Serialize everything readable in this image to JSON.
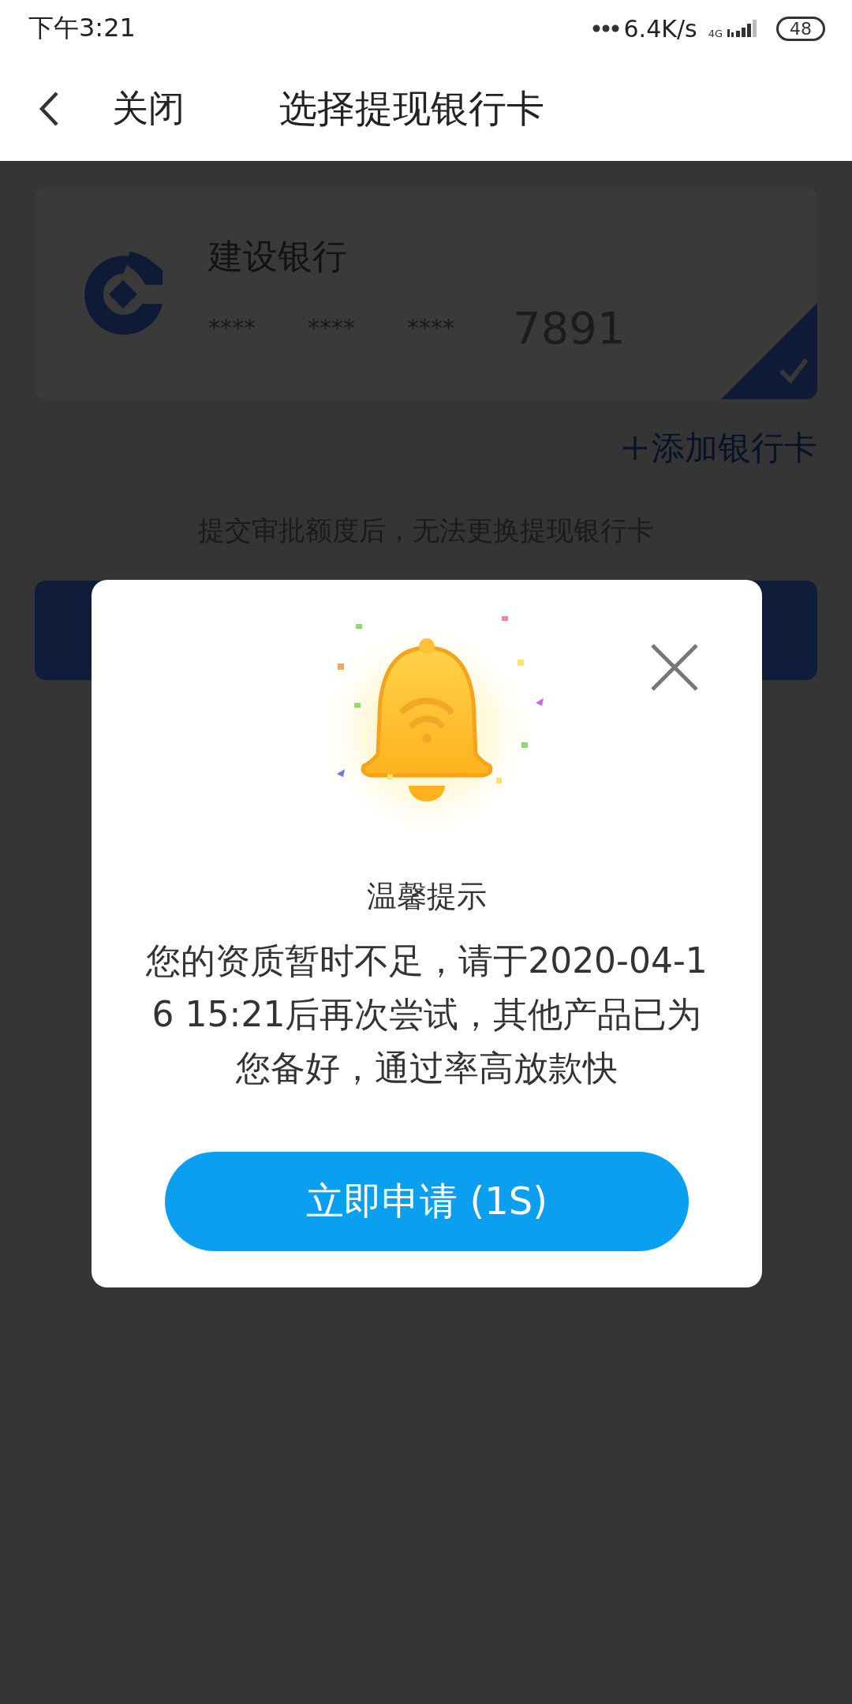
{
  "status_bar": {
    "time": "下午3:21",
    "network_speed": "6.4K/s",
    "network_type": "4G",
    "battery": "48"
  },
  "header": {
    "back_label": "关闭",
    "title": "选择提现银行卡"
  },
  "cards": [
    {
      "bank": "建设银行",
      "masked_groups": [
        "****",
        "****",
        "****"
      ],
      "last_digits": "7891",
      "selected": true
    }
  ],
  "add_card": "添加银行卡",
  "notice": "提交审批额度后，无法更换提现银行卡",
  "dialog": {
    "title": "温馨提示",
    "message": "您的资质暂时不足，请于2020-04-16 15:21后再次尝试，其他产品已为您备好，通过率高放款快",
    "button": "立即申请 (1S)"
  }
}
